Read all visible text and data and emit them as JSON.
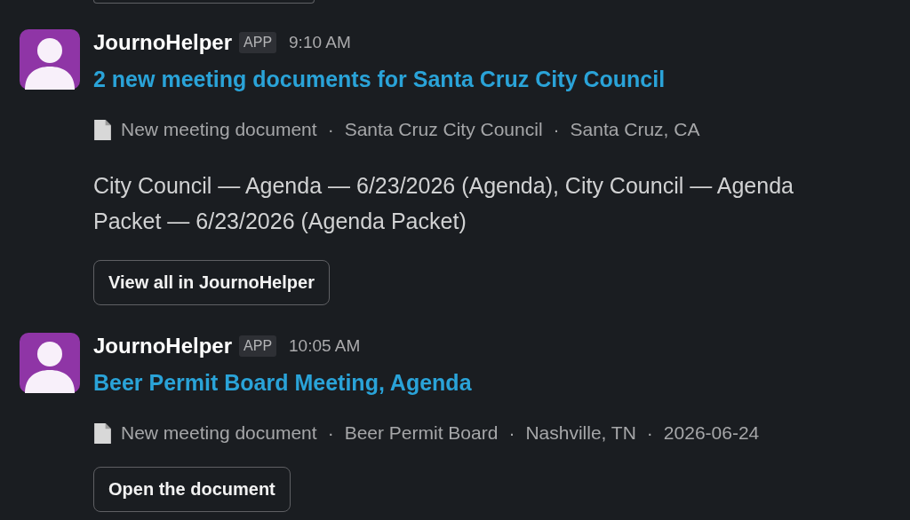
{
  "messages": [
    {
      "sender": "JournoHelper",
      "badge": "APP",
      "time": "9:10 AM",
      "title": "2 new meeting documents for Santa Cruz City Council",
      "meta": [
        "New meeting document",
        "Santa Cruz City Council",
        "Santa Cruz, CA"
      ],
      "separator": "·",
      "body": "City Council — Agenda — 6/23/2026 (Agenda), City Council — Agenda Packet — 6/23/2026 (Agenda Packet)",
      "button": "View all in JournoHelper"
    },
    {
      "sender": "JournoHelper",
      "badge": "APP",
      "time": "10:05 AM",
      "title": "Beer Permit Board Meeting, Agenda",
      "meta": [
        "New meeting document",
        "Beer Permit Board",
        "Nashville, TN",
        "2026-06-24"
      ],
      "separator": "·",
      "button": "Open the document"
    }
  ]
}
